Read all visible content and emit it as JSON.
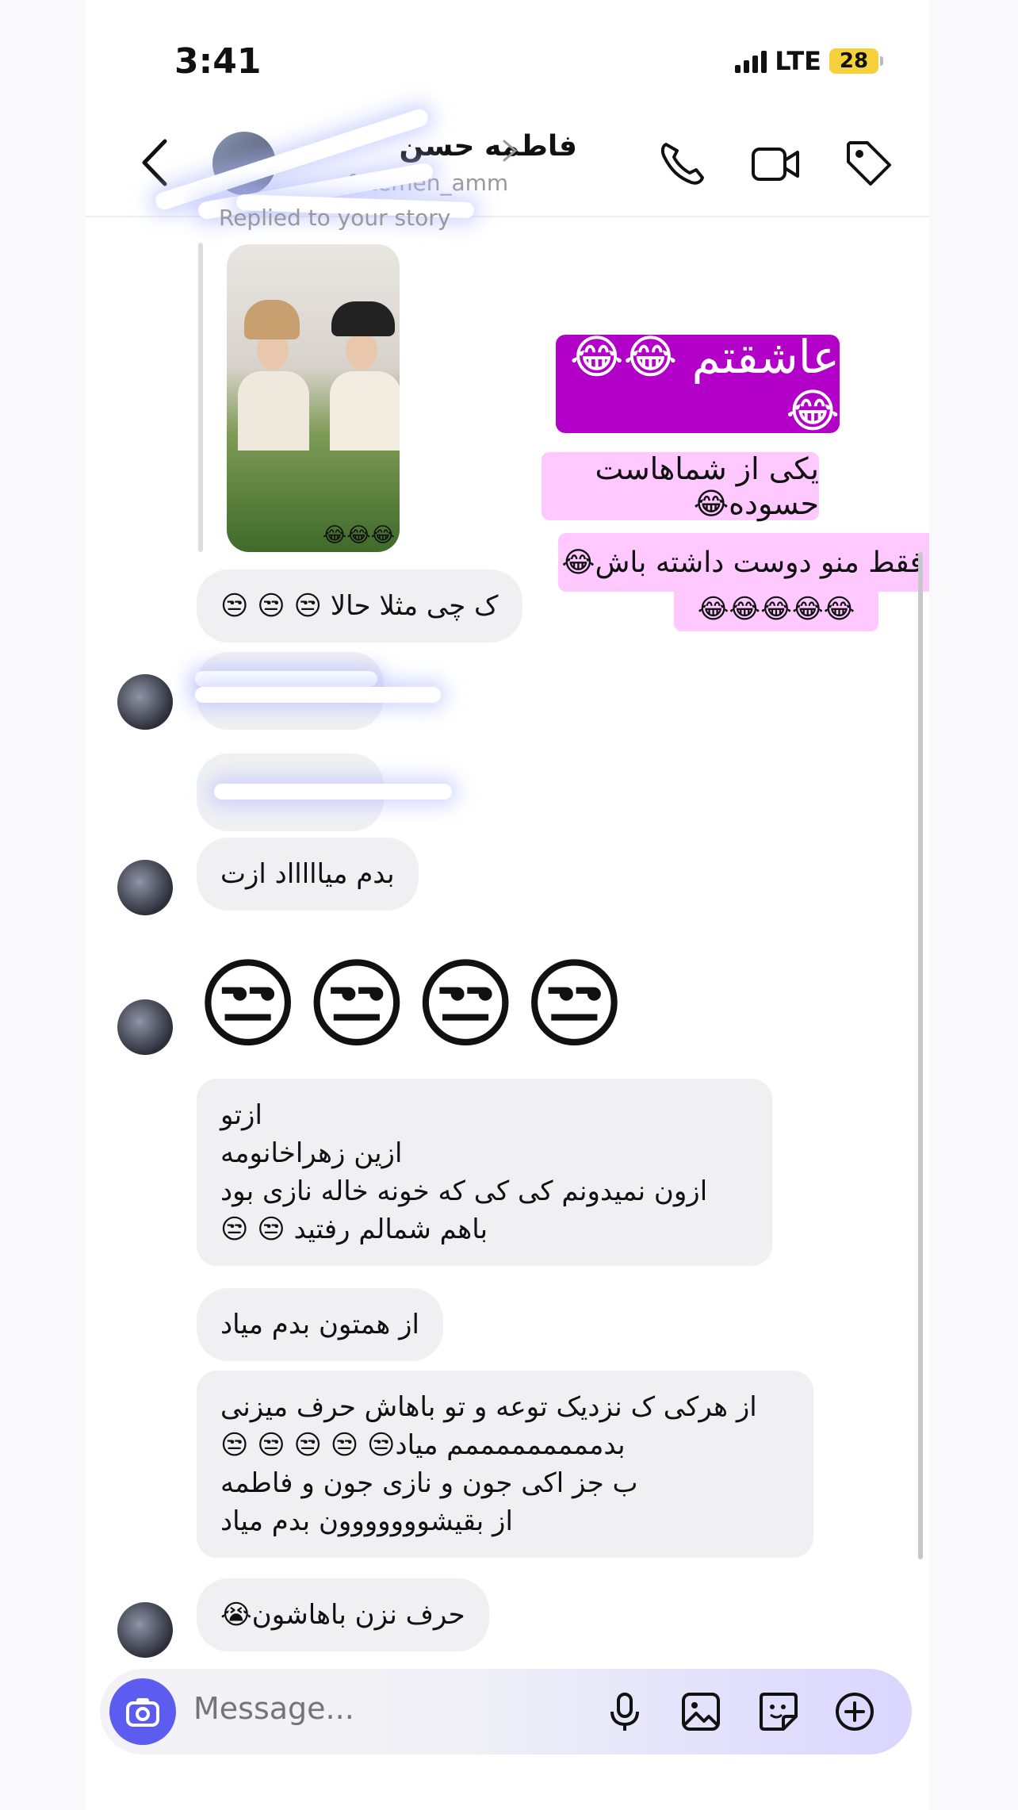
{
  "status": {
    "time": "3:41",
    "network": "LTE",
    "battery": "28"
  },
  "header": {
    "name": "فاطمه حسن",
    "username": "fatemeh_amm",
    "back_icon": "chevron-left-icon",
    "call_icon": "phone-icon",
    "video_icon": "video-camera-icon",
    "tag_icon": "tag-icon"
  },
  "story_reply": {
    "label": "Replied to your story",
    "overlay_emoji": "😂😂😂",
    "stickers": [
      "عاشقتم 😂😂😂",
      "یکی از شماهاست حسوده😂",
      "میگه فقط منو دوست داشته باش😂",
      "😂😂😂😂😂"
    ]
  },
  "messages": [
    "ک چی مثلا حالا 😒 😒 😒",
    "بدم میاااااد ازت",
    "😒😒😒😒",
    [
      "ازتو",
      "ازین زهراخانومه",
      "ازون نمیدونم کی کی که خونه خاله نازی بود",
      "باهم شمالم رفتید 😒 😒"
    ],
    "از همتون بدم میاد",
    [
      "از هرکی ک نزدیک توعه و تو باهاش حرف میزنی",
      "بدمممممممممم میاد😒 😒 😒 😒 😒",
      "ب جز اکی جون و نازی جون و فاطمه",
      "از بقیشووووووون بدم میاد"
    ],
    "حرف نزن باهاشون😭"
  ],
  "composer": {
    "placeholder": "Message...",
    "camera_icon": "camera-icon",
    "mic_icon": "microphone-icon",
    "gallery_icon": "image-icon",
    "sticker_icon": "sticker-icon",
    "plus_icon": "plus-circle-icon"
  }
}
